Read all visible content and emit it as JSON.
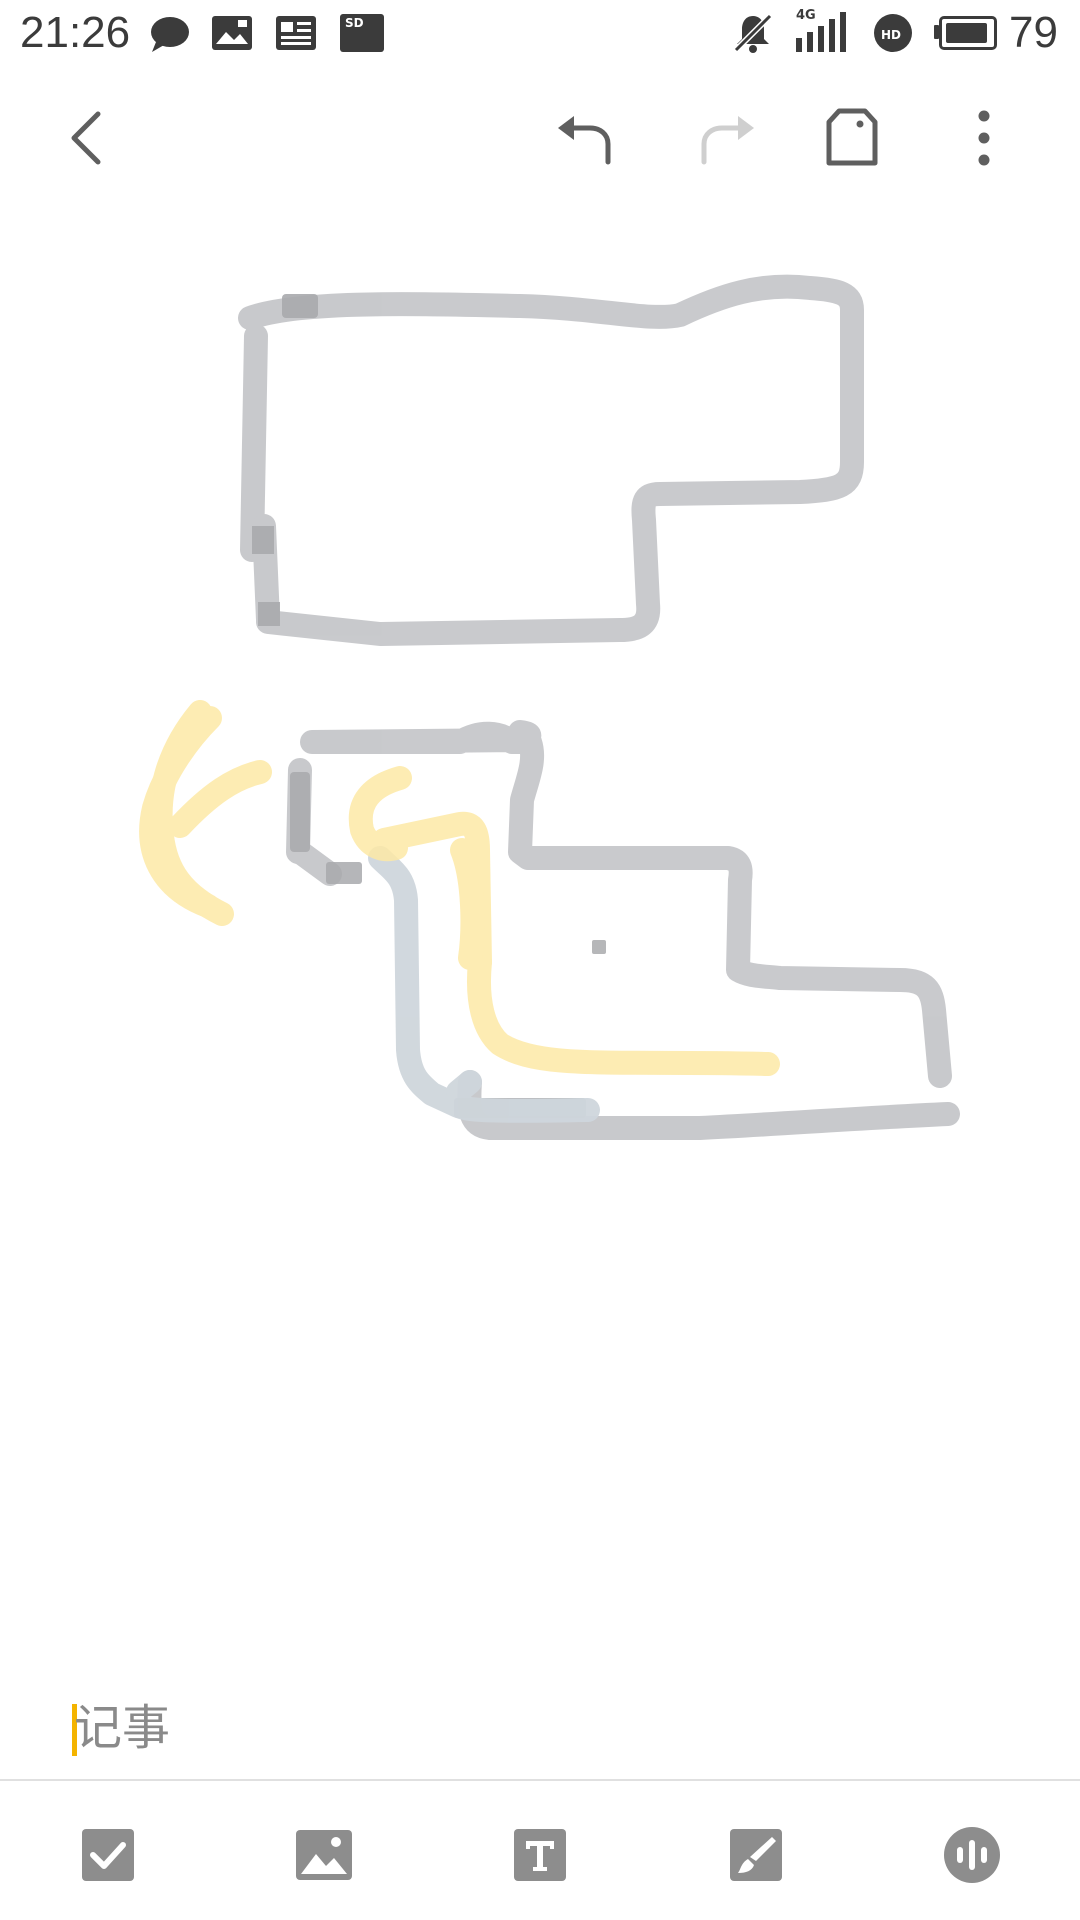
{
  "status_bar": {
    "time": "21:26",
    "battery_percent": "79",
    "network": "4G",
    "icons": [
      "chat-icon",
      "gallery-icon",
      "news-icon",
      "sd-card-icon",
      "bell-muted-icon",
      "signal-icon",
      "hd-icon",
      "battery-icon"
    ],
    "sd_label": "SD",
    "hd_label": "HD"
  },
  "toolbar": {
    "icons": [
      "back-icon",
      "undo-icon",
      "redo-icon",
      "label-icon",
      "more-icon"
    ]
  },
  "note": {
    "placeholder": "记事"
  },
  "bottom_bar": {
    "icons": [
      "checkbox-icon",
      "image-icon",
      "text-icon",
      "brush-icon",
      "voice-icon"
    ]
  },
  "colors": {
    "stroke_gray": "#c6c7ca",
    "stroke_blue_gray": "#cfd6dc",
    "stroke_yellow": "#fde9a6",
    "cursor": "#f4b400",
    "icon_gray": "#8d8d8d"
  }
}
